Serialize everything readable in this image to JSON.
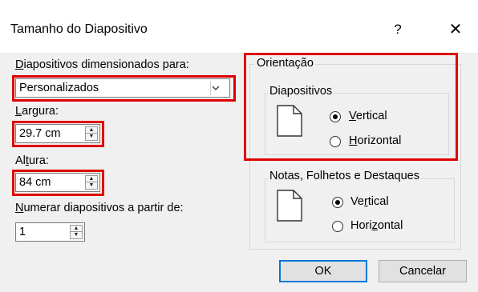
{
  "dialog": {
    "title": "Tamanho do Diapositivo",
    "help_label": "?",
    "close_label": "✕"
  },
  "size": {
    "label": "Diapositivos dimensionados para:",
    "label_access_key": "D",
    "label_rest": "iapositivos dimensionados para:",
    "selected": "Personalizados",
    "dropdown_icon": "chevron-down-icon"
  },
  "width": {
    "label_pre": "",
    "label_key": "L",
    "label_post": "argura:",
    "value": "29.7 cm"
  },
  "height": {
    "label_pre": "Al",
    "label_key": "t",
    "label_post": "ura:",
    "value": "84 cm"
  },
  "numbering": {
    "label_key": "N",
    "label_post": "umerar diapositivos a partir de:",
    "value": "1"
  },
  "orientation": {
    "legend": "Orientação",
    "slides": {
      "legend": "Diapositivos",
      "vertical_key": "V",
      "vertical_rest": "ertical",
      "horizontal_key": "H",
      "horizontal_rest": "orizontal",
      "selected": "Vertical"
    },
    "notes": {
      "legend": "Notas, Folhetos e Destaques",
      "vertical_pre": "Ve",
      "vertical_key": "r",
      "vertical_post": "tical",
      "horizontal_pre": "Hori",
      "horizontal_key": "z",
      "horizontal_post": "ontal",
      "selected": "Vertical"
    }
  },
  "buttons": {
    "ok": "OK",
    "cancel": "Cancelar"
  },
  "colors": {
    "highlight": "#e00000",
    "default_button_border": "#0078d7",
    "dialog_bg": "#f0f0f0"
  }
}
